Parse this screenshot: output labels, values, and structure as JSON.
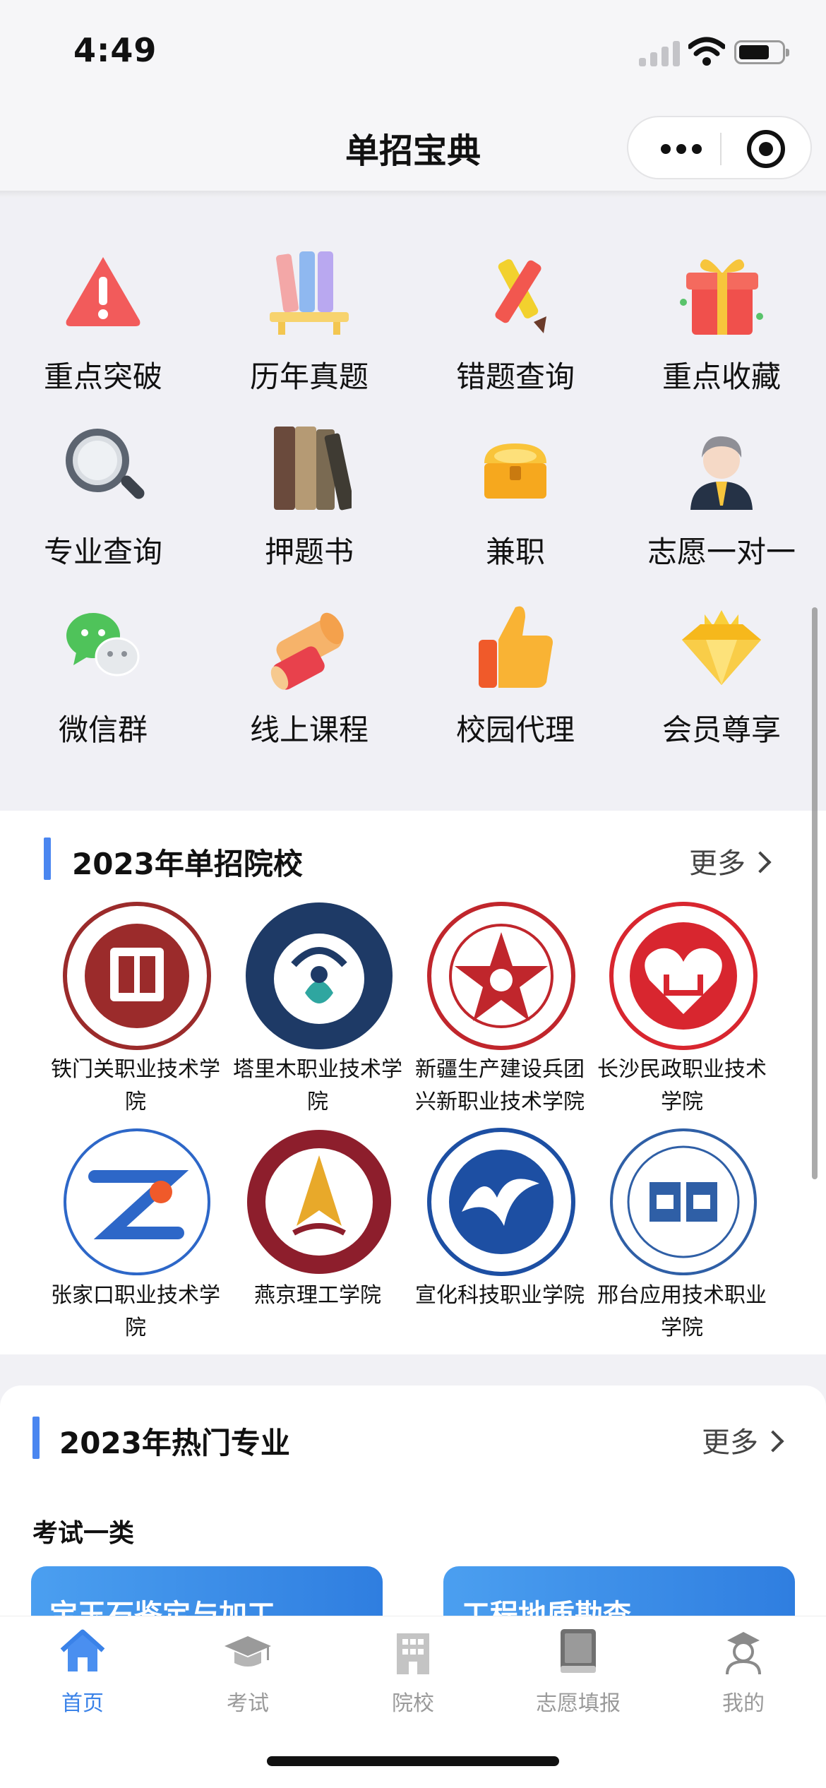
{
  "status_bar": {
    "time": "4:49"
  },
  "nav": {
    "title": "单招宝典"
  },
  "grid_menu": [
    {
      "label": "重点突破",
      "icon": "warning-icon"
    },
    {
      "label": "历年真题",
      "icon": "books-shelf-icon"
    },
    {
      "label": "错题查询",
      "icon": "pencil-icon"
    },
    {
      "label": "重点收藏",
      "icon": "gift-icon"
    },
    {
      "label": "专业查询",
      "icon": "magnifier-icon"
    },
    {
      "label": "押题书",
      "icon": "books-icon"
    },
    {
      "label": "兼职",
      "icon": "treasure-chest-icon"
    },
    {
      "label": "志愿一对一",
      "icon": "advisor-icon"
    },
    {
      "label": "微信群",
      "icon": "wechat-icon"
    },
    {
      "label": "线上课程",
      "icon": "scroll-icon"
    },
    {
      "label": "校园代理",
      "icon": "thumbs-up-icon"
    },
    {
      "label": "会员尊享",
      "icon": "diamond-icon"
    }
  ],
  "colleges": {
    "title": "2023年单招院校",
    "more": "更多",
    "items": [
      {
        "name": "铁门关职业技术学院",
        "color": "#9b2b2b"
      },
      {
        "name": "塔里木职业技术学院",
        "color": "#1e3a66"
      },
      {
        "name": "新疆生产建设兵团兴新职业技术学院",
        "color": "#c0262c"
      },
      {
        "name": "长沙民政职业技术学院",
        "color": "#d8262f"
      },
      {
        "name": "张家口职业技术学院",
        "color": "#2d67c8"
      },
      {
        "name": "燕京理工学院",
        "color": "#8d1e2c"
      },
      {
        "name": "宣化科技职业学院",
        "color": "#1d4fa3"
      },
      {
        "name": "邢台应用技术职业学院",
        "color": "#2f5fa6"
      }
    ]
  },
  "majors": {
    "title": "2023年热门专业",
    "more": "更多",
    "category": "考试一类",
    "tiles": [
      {
        "label": "宝玉石鉴定与加工"
      },
      {
        "label": "工程地质勘查"
      }
    ]
  },
  "tab_bar": [
    {
      "label": "首页",
      "icon": "home-icon",
      "active": true
    },
    {
      "label": "考试",
      "icon": "graduation-cap-icon",
      "active": false
    },
    {
      "label": "院校",
      "icon": "building-icon",
      "active": false
    },
    {
      "label": "志愿填报",
      "icon": "book-icon",
      "active": false
    },
    {
      "label": "我的",
      "icon": "user-icon",
      "active": false
    }
  ]
}
